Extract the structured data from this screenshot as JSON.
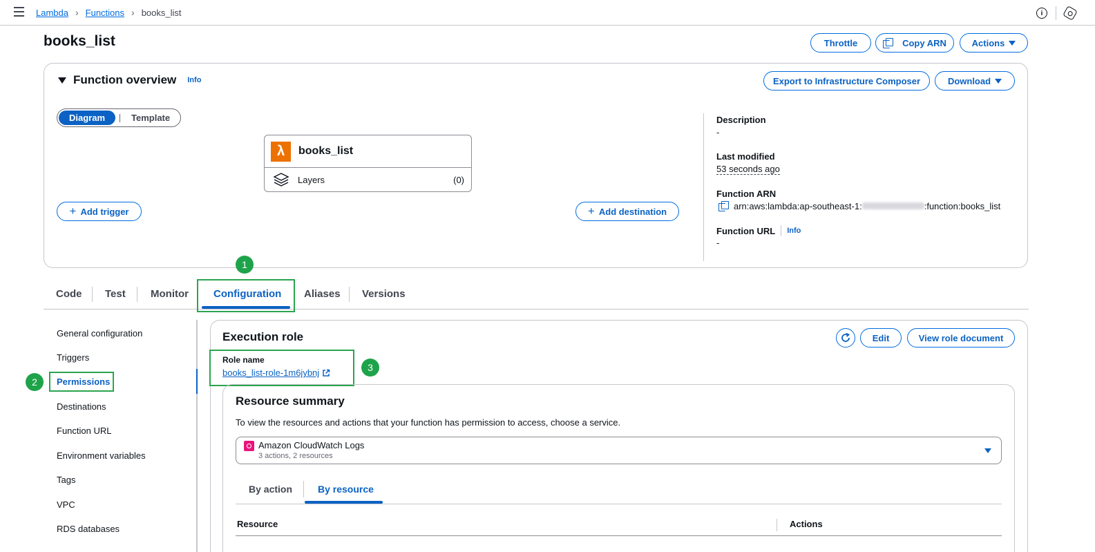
{
  "breadcrumb": {
    "items": [
      "Lambda",
      "Functions",
      "books_list"
    ]
  },
  "page": {
    "title": "books_list",
    "buttons": {
      "throttle": "Throttle",
      "copy_arn": "Copy ARN",
      "actions": "Actions"
    }
  },
  "overview": {
    "title": "Function overview",
    "info": "Info",
    "export_button": "Export to Infrastructure Composer",
    "download_button": "Download",
    "view_toggle": {
      "diagram": "Diagram",
      "template": "Template",
      "selected": "Diagram"
    },
    "function_box": {
      "name": "books_list",
      "layers_label": "Layers",
      "layers_count": "(0)"
    },
    "add_trigger": "Add trigger",
    "add_destination": "Add destination",
    "meta": {
      "description_label": "Description",
      "description_value": "-",
      "last_modified_label": "Last modified",
      "last_modified_value": "53 seconds ago",
      "arn_label": "Function ARN",
      "arn_prefix": "arn:aws:lambda:ap-southeast-1:",
      "arn_suffix": ":function:books_list",
      "url_label": "Function URL",
      "url_info": "Info",
      "url_value": "-"
    }
  },
  "tabs": {
    "items": [
      "Code",
      "Test",
      "Monitor",
      "Configuration",
      "Aliases",
      "Versions"
    ],
    "active": "Configuration"
  },
  "sidenav": {
    "items": [
      "General configuration",
      "Triggers",
      "Permissions",
      "Destinations",
      "Function URL",
      "Environment variables",
      "Tags",
      "VPC",
      "RDS databases"
    ],
    "active": "Permissions"
  },
  "execution_role": {
    "title": "Execution role",
    "edit": "Edit",
    "view_role_document": "View role document",
    "role_name_label": "Role name",
    "role_name_value": "books_list-role-1m6jybnj"
  },
  "resource_summary": {
    "title": "Resource summary",
    "description": "To view the resources and actions that your function has permission to access, choose a service.",
    "service_select": {
      "selected": "Amazon CloudWatch Logs",
      "detail": "3 actions, 2 resources"
    },
    "subtabs": [
      "By action",
      "By resource"
    ],
    "active_subtab": "By resource",
    "columns": [
      "Resource",
      "Actions"
    ]
  },
  "annotations": [
    "1",
    "2",
    "3"
  ],
  "colors": {
    "accent": "#0b62c4",
    "highlight": "#2aa44f",
    "lambda_icon": "#ed7100",
    "cloudwatch_icon": "#e7157b"
  }
}
